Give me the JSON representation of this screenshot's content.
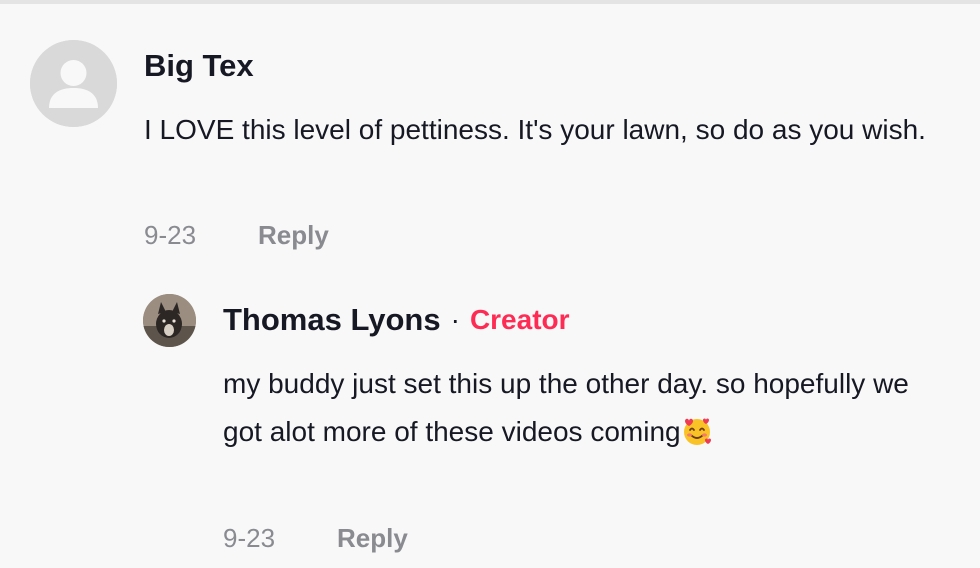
{
  "comments": [
    {
      "author": "Big Tex",
      "text": "I LOVE this level of pettiness. It's your lawn, so do as you wish.",
      "date": "9-23",
      "reply_label": "Reply",
      "avatar_icon": "default-user-avatar-icon"
    }
  ],
  "reply": {
    "author": "Thomas Lyons",
    "separator": "·",
    "badge": "Creator",
    "text": "my buddy just set this up the other day. so hopefully we got alot more of these videos coming",
    "emoji_icon": "smiling-face-with-hearts-icon",
    "date": "9-23",
    "reply_label": "Reply"
  },
  "colors": {
    "background": "#f8f8f8",
    "text": "#161823",
    "muted": "#8a8b91",
    "creator_badge": "#fe2c55"
  }
}
